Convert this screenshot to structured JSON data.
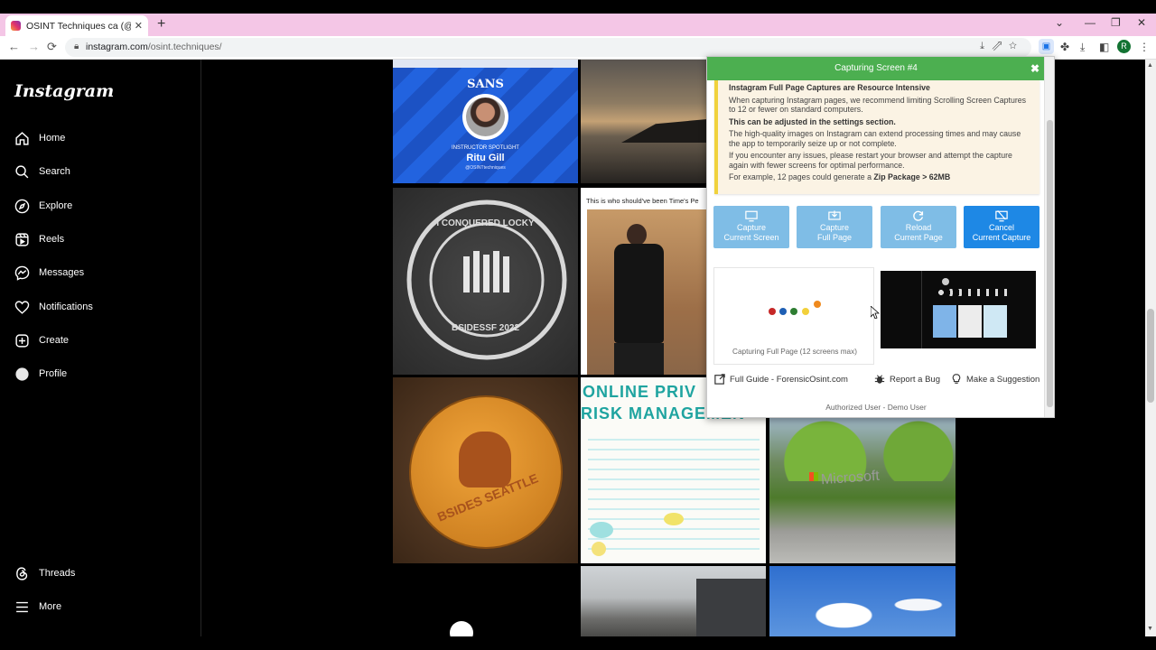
{
  "browser": {
    "tab_title": "OSINT Techniques ca (@osint.te",
    "tab_close": "✕",
    "new_tab": "+",
    "url_domain": "instagram.com",
    "url_path": "/osint.techniques/",
    "profile_initial": "R"
  },
  "instagram": {
    "logo": "Instagram",
    "nav": [
      {
        "label": "Home",
        "icon": "home-icon"
      },
      {
        "label": "Search",
        "icon": "search-icon"
      },
      {
        "label": "Explore",
        "icon": "compass-icon"
      },
      {
        "label": "Reels",
        "icon": "reels-icon"
      },
      {
        "label": "Messages",
        "icon": "messenger-icon"
      },
      {
        "label": "Notifications",
        "icon": "heart-icon"
      },
      {
        "label": "Create",
        "icon": "plus-square-icon"
      },
      {
        "label": "Profile",
        "icon": "avatar-icon"
      }
    ],
    "bottom_nav": [
      {
        "label": "Threads",
        "icon": "threads-icon"
      },
      {
        "label": "More",
        "icon": "menu-icon"
      }
    ],
    "posts": {
      "sans_brand": "SANS",
      "sans_spotlight": "INSTRUCTOR SPOTLIGHT",
      "sans_name": "Ritu Gill",
      "sans_handle": "@OSINTtechniques",
      "locky_badge": "I CONQUERED LOCKY",
      "locky_event": "BSIDESSF 2022",
      "times_caption": "This is who should've been Time's Pe",
      "bsides_seattle": "BSIDES SEATTLE",
      "privacy_title_1": "ONLINE PRIV",
      "privacy_title_2": "RISK MANAGEMEN",
      "microsoft_sign": "Microsoft"
    }
  },
  "extension": {
    "header": "Capturing Screen #4",
    "close": "✖",
    "warning_title": "Instagram Full Page Captures are Resource Intensive",
    "warning_p1": "When capturing Instagram pages, we recommend limiting Scrolling Screen Captures to 12 or fewer on standard computers.",
    "warning_p2": "This can be adjusted in the settings section.",
    "warning_p3": "The high-quality images on Instagram can extend processing times and may cause the app to temporarily seize up or not complete.",
    "warning_p4": "If you encounter any issues, please restart your browser and attempt the capture again with fewer screens for optimal performance.",
    "warning_p5_prefix": "For example, 12 pages could generate a ",
    "warning_p5_bold": "Zip Package > 62MB",
    "buttons": [
      {
        "line1": "Capture",
        "line2": "Current Screen",
        "icon": "monitor-icon"
      },
      {
        "line1": "Capture",
        "line2": "Full Page",
        "icon": "download-screen-icon"
      },
      {
        "line1": "Reload",
        "line2": "Current Page",
        "icon": "reload-icon"
      },
      {
        "line1": "Cancel",
        "line2": "Current Capture",
        "icon": "monitor-cancel-icon"
      }
    ],
    "progress_label": "Capturing Full Page (12 screens max)",
    "dot_colors": [
      "#c62828",
      "#1e5fb4",
      "#2e7d32",
      "#f2d03b",
      "#ef8a1e"
    ],
    "footer_guide": "Full Guide - ForensicOsint.com",
    "footer_bug": "Report a Bug",
    "footer_suggest": "Make a Suggestion",
    "auth_user": "Authorized User - Demo User"
  }
}
